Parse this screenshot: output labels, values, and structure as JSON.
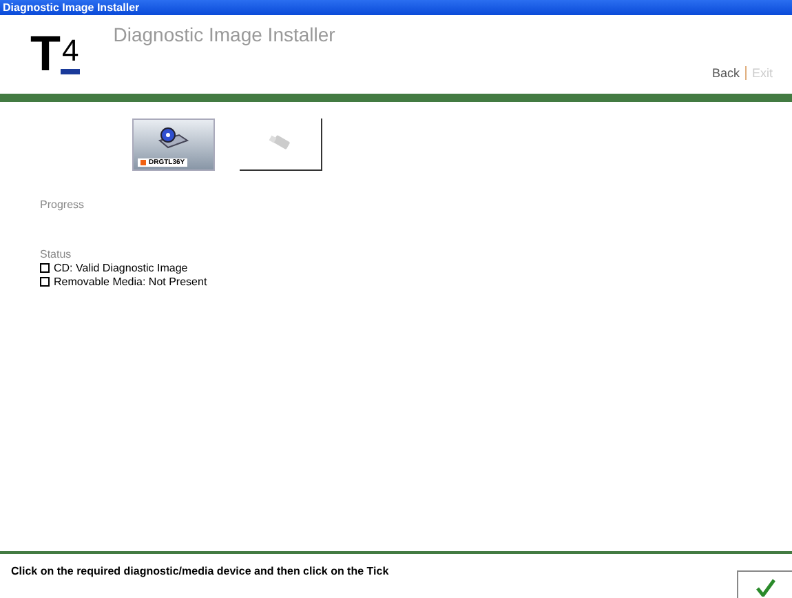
{
  "window": {
    "title": "Diagnostic Image Installer"
  },
  "header": {
    "logo": {
      "letter": "T",
      "digit": "4"
    },
    "title": "Diagnostic Image Installer",
    "nav": [
      {
        "label": "Back",
        "disabled": false
      },
      {
        "label": "Exit",
        "disabled": true
      }
    ]
  },
  "devices": [
    {
      "kind": "cd",
      "label": "DRGTL36Y",
      "selected": true
    },
    {
      "kind": "usb",
      "selected": false
    }
  ],
  "progress": {
    "label": "Progress"
  },
  "status": {
    "label": "Status",
    "items": [
      {
        "text": "CD: Valid Diagnostic Image",
        "checked": false
      },
      {
        "text": "Removable Media: Not Present",
        "checked": false
      }
    ]
  },
  "footer": {
    "instruction": "Click on the required diagnostic/media device and then click on the Tick"
  }
}
